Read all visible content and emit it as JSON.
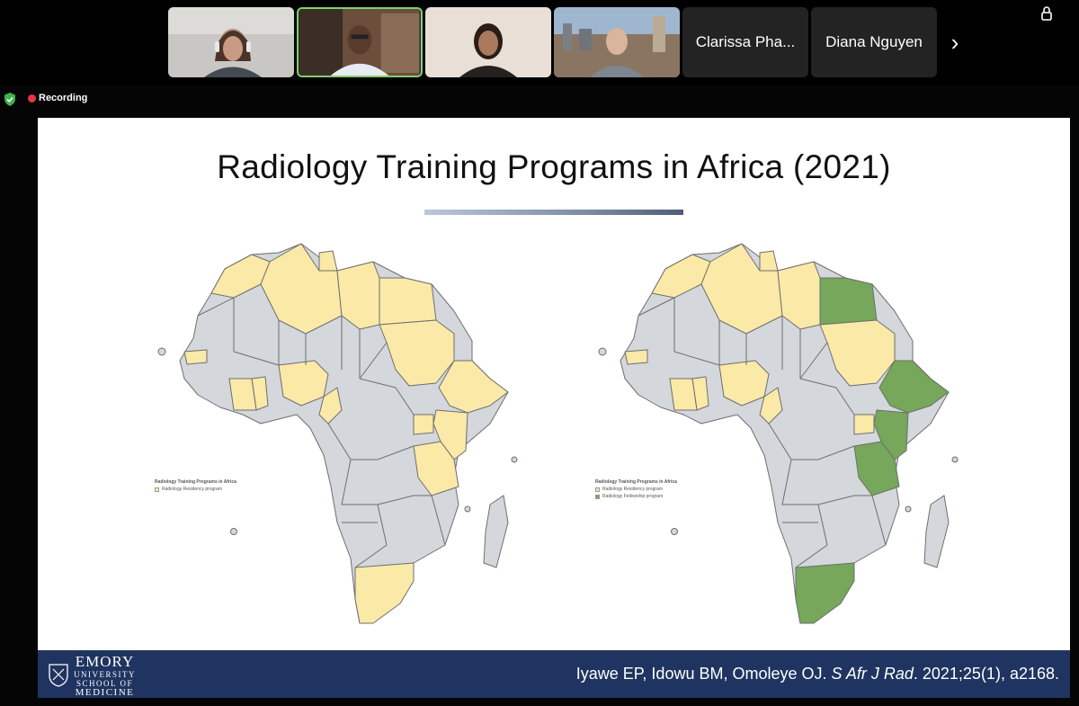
{
  "participants": {
    "video_tiles": [
      {
        "name": "participant-1"
      },
      {
        "name": "participant-2"
      },
      {
        "name": "participant-3"
      },
      {
        "name": "participant-4"
      }
    ],
    "name_tiles": [
      "Clarissa Pha...",
      "Diana Nguyen"
    ],
    "next_icon": "chevron-right-icon"
  },
  "recording": {
    "label": "Recording",
    "security_icon": "shield-check-icon"
  },
  "slide": {
    "title": "Radiology Training Programs in Africa (2021)",
    "map_left": {
      "legend_title": "Radiology Training Programs in Africa",
      "legend_items": [
        "Radiology Residency program"
      ]
    },
    "map_right": {
      "legend_title": "Radiology Training Programs in Africa",
      "legend_items": [
        "Radiology Residency program",
        "Radiology Fellowship program"
      ]
    },
    "colors": {
      "residency": "#fbe9a8",
      "fellowship": "#76a75a",
      "none": "#d4d7dc",
      "border": "#6e6e6e"
    },
    "footer": {
      "logo_name": "EMORY",
      "logo_line2": "UNIVERSITY",
      "logo_line3": "SCHOOL OF",
      "logo_line4": "MEDICINE",
      "citation_authors": "Iyawe EP, Idowu BM, Omoleye OJ. ",
      "citation_journal": "S Afr J Rad",
      "citation_rest": ". 2021;25(1), a2168."
    }
  }
}
